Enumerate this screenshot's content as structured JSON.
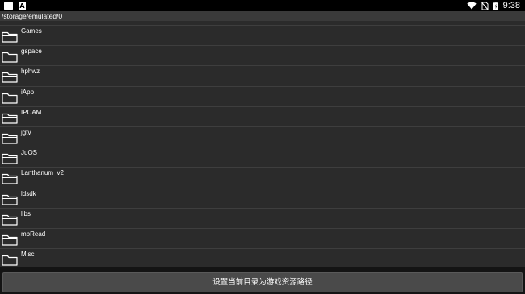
{
  "status_bar": {
    "time": "9:38",
    "left_icons": [
      "app-icon",
      "a-notification-icon"
    ],
    "right_icons": [
      "wifi-icon",
      "no-sim-icon",
      "battery-icon"
    ]
  },
  "path_bar": {
    "path": "/storage/emulated/0"
  },
  "file_list": {
    "items": [
      {
        "label": "Games",
        "icon": "folder-icon"
      },
      {
        "label": "gspace",
        "icon": "folder-icon"
      },
      {
        "label": "hphwz",
        "icon": "folder-icon"
      },
      {
        "label": "iApp",
        "icon": "folder-icon"
      },
      {
        "label": "IPCAM",
        "icon": "folder-icon"
      },
      {
        "label": "jgtv",
        "icon": "folder-icon"
      },
      {
        "label": "JuOS",
        "icon": "folder-icon"
      },
      {
        "label": "Lanthanum_v2",
        "icon": "folder-icon"
      },
      {
        "label": "ldsdk",
        "icon": "folder-icon"
      },
      {
        "label": "libs",
        "icon": "folder-icon"
      },
      {
        "label": "mbRead",
        "icon": "folder-icon"
      },
      {
        "label": "Misc",
        "icon": "folder-icon"
      }
    ]
  },
  "bottom_bar": {
    "button_label": "设置当前目录为游戏资源路径"
  },
  "colors": {
    "background": "#2b2b2b",
    "path_bar": "#3a3a3a",
    "divider": "#3e3e3e",
    "button": "#4a4a4a",
    "text": "#ffffff"
  }
}
